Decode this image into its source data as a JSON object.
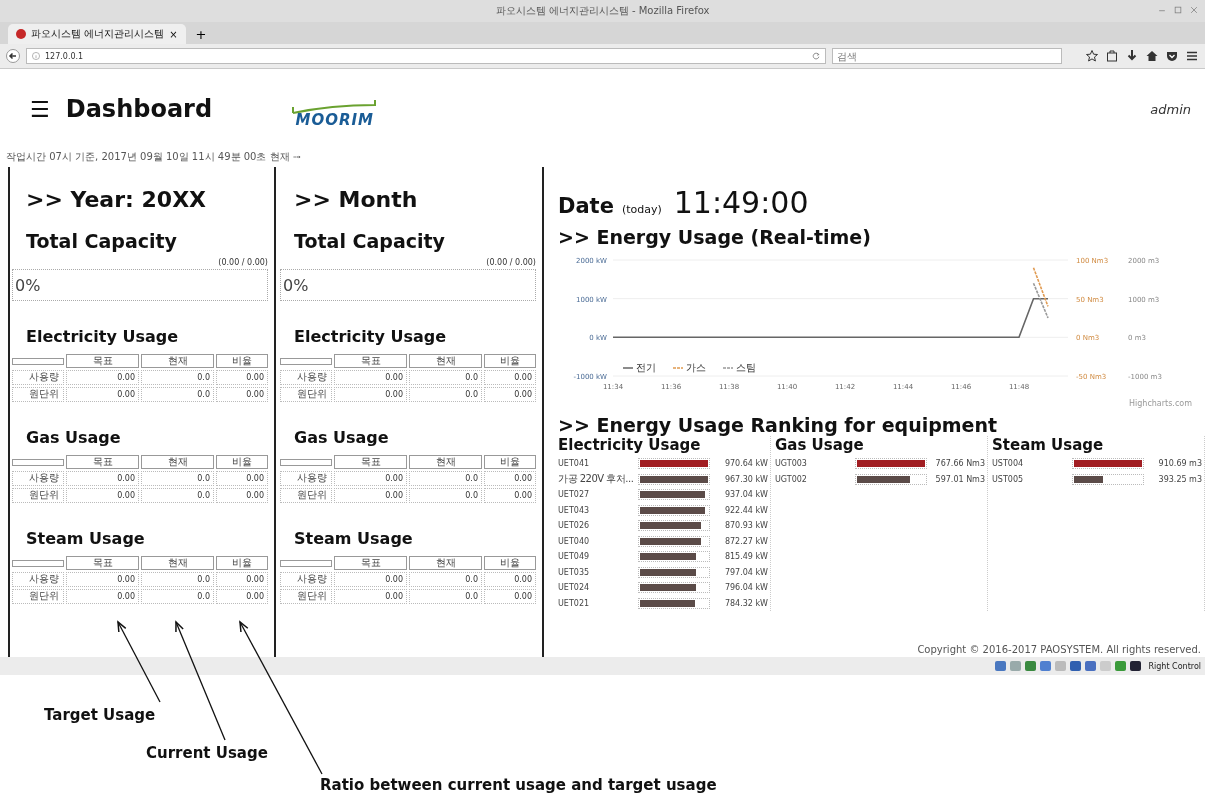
{
  "window": {
    "title": "파오시스템 에너지관리시스템 - Mozilla Firefox"
  },
  "browser": {
    "tabs": [
      {
        "title": "파오시스템 에너지관리시스템",
        "close": "×",
        "selected": true
      }
    ],
    "new_tab": "+",
    "url": "127.0.0.1",
    "search": {
      "placeholder": "검색"
    }
  },
  "header": {
    "menu": "☰",
    "title": "Dashboard",
    "logo": "MOORIM",
    "user": "admin"
  },
  "status_text": "작업시간 07시 기준, 2017년 09월 10일 11시 49분 00초 현재",
  "panels": [
    {
      "heading": ">> Year: 20XX",
      "capacity": {
        "title": "Total Capacity",
        "reading": "(0.00 / 0.00)",
        "percent": "0%"
      },
      "usages": [
        {
          "title": "Electricity Usage",
          "columns": [
            "목표",
            "현재",
            "비율"
          ],
          "rows": [
            {
              "label": "사용량",
              "values": [
                "0.00",
                "0.0",
                "0.00"
              ]
            },
            {
              "label": "원단위",
              "values": [
                "0.00",
                "0.0",
                "0.00"
              ]
            }
          ]
        },
        {
          "title": "Gas Usage",
          "columns": [
            "목표",
            "현재",
            "비율"
          ],
          "rows": [
            {
              "label": "사용량",
              "values": [
                "0.00",
                "0.0",
                "0.00"
              ]
            },
            {
              "label": "원단위",
              "values": [
                "0.00",
                "0.0",
                "0.00"
              ]
            }
          ]
        },
        {
          "title": "Steam Usage",
          "columns": [
            "목표",
            "현재",
            "비율"
          ],
          "rows": [
            {
              "label": "사용량",
              "values": [
                "0.00",
                "0.0",
                "0.00"
              ]
            },
            {
              "label": "원단위",
              "values": [
                "0.00",
                "0.0",
                "0.00"
              ]
            }
          ]
        }
      ]
    },
    {
      "heading": ">> Month",
      "capacity": {
        "title": "Total Capacity",
        "reading": "(0.00 / 0.00)",
        "percent": "0%"
      },
      "usages": [
        {
          "title": "Electricity Usage",
          "columns": [
            "목표",
            "현재",
            "비율"
          ],
          "rows": [
            {
              "label": "사용량",
              "values": [
                "0.00",
                "0.0",
                "0.00"
              ]
            },
            {
              "label": "원단위",
              "values": [
                "0.00",
                "0.0",
                "0.00"
              ]
            }
          ]
        },
        {
          "title": "Gas Usage",
          "columns": [
            "목표",
            "현재",
            "비율"
          ],
          "rows": [
            {
              "label": "사용량",
              "values": [
                "0.00",
                "0.0",
                "0.00"
              ]
            },
            {
              "label": "원단위",
              "values": [
                "0.00",
                "0.0",
                "0.00"
              ]
            }
          ]
        },
        {
          "title": "Steam Usage",
          "columns": [
            "목표",
            "현재",
            "비율"
          ],
          "rows": [
            {
              "label": "사용량",
              "values": [
                "0.00",
                "0.0",
                "0.00"
              ]
            },
            {
              "label": "원단위",
              "values": [
                "0.00",
                "0.0",
                "0.00"
              ]
            }
          ]
        }
      ]
    }
  ],
  "today": {
    "label": "Date",
    "note": "(today)",
    "time": "11:49:00"
  },
  "realtime": {
    "title": ">> Energy Usage (Real-time)",
    "right_axis_1": [
      "100 Nm3",
      "50 Nm3",
      "0 Nm3",
      "-50 Nm3"
    ],
    "right_axis_2": [
      "2000 m3",
      "1000 m3",
      "0 m3",
      "-1000 m3"
    ],
    "credit": "Highcharts.com",
    "chart_data": {
      "type": "line",
      "categories": [
        "11:34",
        null,
        null,
        null,
        "11:36",
        null,
        null,
        null,
        "11:38",
        null,
        null,
        null,
        "11:40",
        null,
        null,
        null,
        "11:42",
        null,
        null,
        null,
        "11:44",
        null,
        null,
        null,
        "11:46",
        null,
        null,
        null,
        "11:48",
        null,
        null
      ],
      "legend": "lower left",
      "ylim": [
        -1000,
        2000
      ],
      "yticks": [
        {
          "value": -1000,
          "label": "-1000 kW"
        },
        {
          "value": 0,
          "label": "0 kW"
        },
        {
          "value": 1000,
          "label": "1000 kW"
        },
        {
          "value": 2000,
          "label": "2000 kW"
        }
      ],
      "series": [
        {
          "name": "전기",
          "color": "#666666",
          "line_style": "solid",
          "values": [
            0,
            0,
            0,
            0,
            0,
            0,
            0,
            0,
            0,
            0,
            0,
            0,
            0,
            0,
            0,
            0,
            0,
            0,
            0,
            0,
            0,
            0,
            0,
            0,
            0,
            0,
            0,
            0,
            0,
            1000,
            1000
          ]
        },
        {
          "name": "가스",
          "color": "#e09a50",
          "line_style": "dashed",
          "values": [
            null,
            null,
            null,
            null,
            null,
            null,
            null,
            null,
            null,
            null,
            null,
            null,
            null,
            null,
            null,
            null,
            null,
            null,
            null,
            null,
            null,
            null,
            null,
            null,
            null,
            null,
            null,
            null,
            null,
            1800,
            800
          ]
        },
        {
          "name": "스팀",
          "color": "#999999",
          "line_style": "dashed",
          "values": [
            null,
            null,
            null,
            null,
            null,
            null,
            null,
            null,
            null,
            null,
            null,
            null,
            null,
            null,
            null,
            null,
            null,
            null,
            null,
            null,
            null,
            null,
            null,
            null,
            null,
            null,
            null,
            null,
            null,
            1400,
            500
          ]
        }
      ]
    }
  },
  "ranking": {
    "title": ">> Energy Usage Ranking for equipment",
    "groups": [
      {
        "title": "Electricity Usage",
        "items": [
          {
            "name": "UET041",
            "value": "970.64 kW",
            "level": 1,
            "color": "#a11d22"
          },
          {
            "name": "가공 220V 후처...",
            "value": "967.30 kW",
            "level": 1,
            "color": "#5b4b48"
          },
          {
            "name": "UET027",
            "value": "937.04 kW",
            "level": 0.96,
            "color": "#5b4b48"
          },
          {
            "name": "UET043",
            "value": "922.44 kW",
            "level": 0.95,
            "color": "#5b4b48"
          },
          {
            "name": "UET026",
            "value": "870.93 kW",
            "level": 0.9,
            "color": "#5b4b48"
          },
          {
            "name": "UET040",
            "value": "872.27 kW",
            "level": 0.9,
            "color": "#5b4b48"
          },
          {
            "name": "UET049",
            "value": "815.49 kW",
            "level": 0.83,
            "color": "#5b4b48"
          },
          {
            "name": "UET035",
            "value": "797.04 kW",
            "level": 0.82,
            "color": "#5b4b48"
          },
          {
            "name": "UET024",
            "value": "796.04 kW",
            "level": 0.82,
            "color": "#5b4b48"
          },
          {
            "name": "UET021",
            "value": "784.32 kW",
            "level": 0.81,
            "color": "#5b4b48"
          }
        ]
      },
      {
        "title": "Gas Usage",
        "items": [
          {
            "name": "UGT003",
            "value": "767.66 Nm3",
            "level": 1,
            "color": "#a11d22"
          },
          {
            "name": "UGT002",
            "value": "597.01 Nm3",
            "level": 0.78,
            "color": "#5b4b48"
          }
        ]
      },
      {
        "title": "Steam Usage",
        "items": [
          {
            "name": "UST004",
            "value": "910.69 m3",
            "level": 1,
            "color": "#a11d22"
          },
          {
            "name": "UST005",
            "value": "393.25 m3",
            "level": 0.43,
            "color": "#5b4b48"
          }
        ]
      }
    ]
  },
  "copyright": "Copyright © 2016-2017 PAOSYSTEM. All rights reserved.",
  "taskbar": {
    "label": "Right Control"
  },
  "annotations": [
    {
      "text": "Target Usage"
    },
    {
      "text": "Current Usage"
    },
    {
      "text": "Ratio between current usage and target usage"
    }
  ]
}
